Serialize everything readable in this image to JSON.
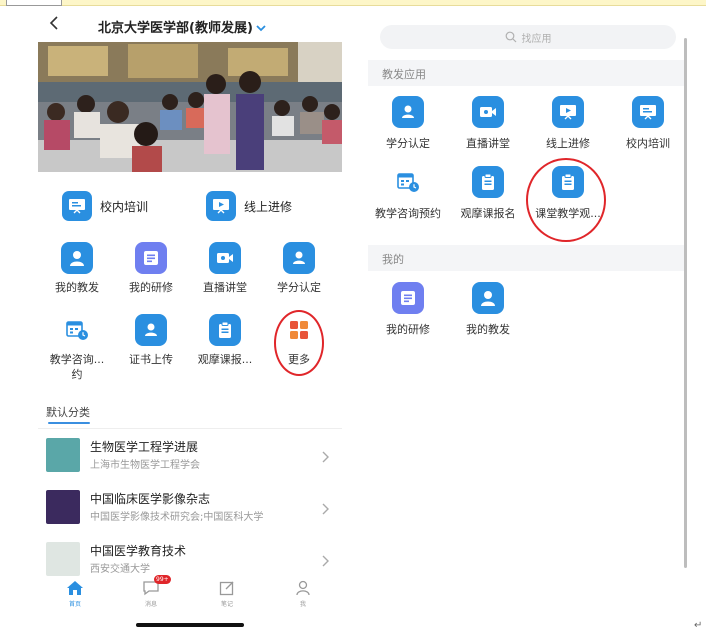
{
  "left": {
    "header": {
      "title": "北京大学医学部(教师发展)"
    },
    "featured": [
      {
        "label": "校内培训",
        "icon": "presentation-icon"
      },
      {
        "label": "线上进修",
        "icon": "online-screen-icon"
      }
    ],
    "grid": [
      {
        "label": "我的教发",
        "icon": "user-avatar-icon",
        "color": "#2a8fe0"
      },
      {
        "label": "我的研修",
        "icon": "list-card-icon",
        "color": "#6f7ff0"
      },
      {
        "label": "直播讲堂",
        "icon": "video-camera-icon",
        "color": "#2a8fe0"
      },
      {
        "label": "学分认定",
        "icon": "person-badge-icon",
        "color": "#2a8fe0"
      },
      {
        "label": "教学咨询...",
        "label2": "约",
        "icon": "calendar-clock-icon",
        "color": "#2a8fe0"
      },
      {
        "label": "证书上传",
        "icon": "person-badge-icon",
        "color": "#2a8fe0"
      },
      {
        "label": "观摩课报...",
        "icon": "clipboard-icon",
        "color": "#2a8fe0"
      },
      {
        "label": "更多",
        "icon": "more-grid-icon",
        "color": "#e8553a"
      }
    ],
    "section_title": "默认分类",
    "list": [
      {
        "title": "生物医学工程学进展",
        "subtitle": "上海市生物医学工程学会",
        "cover_color": "#5aa7a8"
      },
      {
        "title": "中国临床医学影像杂志",
        "subtitle": "中国医学影像技术研究会;中国医科大学",
        "cover_color": "#3b2a5e"
      },
      {
        "title": "中国医学教育技术",
        "subtitle": "西安交通大学",
        "cover_color": "#dfe6e2"
      }
    ],
    "tabs": [
      {
        "label": "首页",
        "icon": "home-icon",
        "active": true
      },
      {
        "label": "消息",
        "icon": "chat-bubble-icon",
        "badge": "99+"
      },
      {
        "label": "笔记",
        "icon": "edit-note-icon"
      },
      {
        "label": "我",
        "icon": "person-icon"
      }
    ]
  },
  "right": {
    "search_placeholder": "找应用",
    "section1": "教发应用",
    "apps1": [
      {
        "label": "学分认定",
        "icon": "person-badge-icon"
      },
      {
        "label": "直播讲堂",
        "icon": "video-camera-icon"
      },
      {
        "label": "线上进修",
        "icon": "online-screen-icon"
      },
      {
        "label": "校内培训",
        "icon": "presentation-icon"
      },
      {
        "label": "教学咨询预约",
        "icon": "calendar-clock-icon"
      },
      {
        "label": "观摩课报名",
        "icon": "clipboard-icon"
      },
      {
        "label": "课堂教学观...",
        "icon": "clipboard-icon"
      }
    ],
    "section2": "我的",
    "apps2": [
      {
        "label": "我的研修",
        "icon": "list-card-icon"
      },
      {
        "label": "我的教发",
        "icon": "user-avatar-icon"
      }
    ]
  }
}
